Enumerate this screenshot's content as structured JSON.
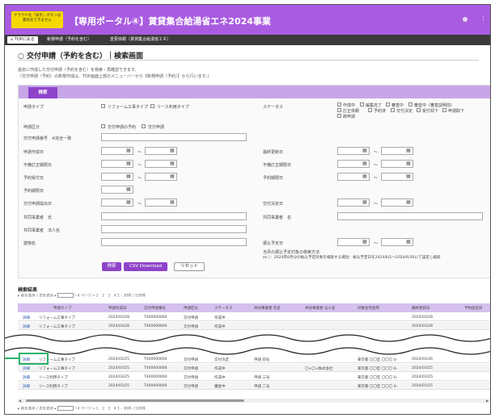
{
  "header": {
    "badge_line1": "クラウド化「表示」ボタンは",
    "badge_line2": "無効化できません",
    "title": "【専用ポータル④】賃貸集合給湯省エネ2024事業",
    "more_icon": "⋮"
  },
  "nav": {
    "home": "TOPに戻る",
    "items": [
      "新規申請（予約を含む）",
      "変更依頼（賃貸集合給湯省エネ）"
    ]
  },
  "page": {
    "title": "○ 交付申請（予約を含む）｜検索画面",
    "desc1": "過去に作成した交付申請（予約を含む）を検索・再確認できます。",
    "desc2": "（交付申請（予約）の新規作成は、TOP画面上部のメニューバーから【新規申請（予約）】から行います。）"
  },
  "search": {
    "tab_label": "検索",
    "labels": {
      "apply_type": "申請タイプ",
      "status": "ステータス",
      "apply_category": "申請区分",
      "apply_number": "交付申請番号",
      "apply_number_note": "※完全一致",
      "created_date": "申請作成日",
      "last_updated": "最終更新日",
      "defect_date": "不備訂正期限日",
      "defect_fix_date": "不備訂正期限日",
      "booking_date": "予約受付日",
      "booking_deadline": "予約期限日",
      "booking_limit": "予約期限日",
      "submit_date": "交付申請提出日",
      "decision_date": "交付決定日",
      "joint_name": "共同事業者　氏",
      "joint_name_first": "共同事業者　名",
      "joint_corp": "共同事業者　法人名",
      "building": "建物名",
      "transfer_date": "振込予定日"
    },
    "type_options": [
      "リフォーム工事タイプ",
      "リース利用タイプ"
    ],
    "category_options": [
      "交付申請の予約",
      "交付申請"
    ],
    "status_options": [
      "作成中",
      "編集完了",
      "審査中",
      "審査中（審査説明前）",
      "訂正依頼",
      "予約済",
      "交付決定",
      "受付却下",
      "申請取下",
      "辞申請"
    ],
    "tilde": "～",
    "calendar_icon": "▦",
    "transfer_note1": "当月の振込予定対象の検索方法",
    "transfer_note2": "ex.）：2024年6月分の振込予定対象を検索する場合：振込予定日を2024/6/1～2024/6/30にて設定し検索",
    "btn_search": "検索",
    "btn_csv": "CSV Download",
    "btn_reset": "リセット"
  },
  "results": {
    "title": "検索結果",
    "pager_text_before": "▸ 前を表示 / 次を表示 ▸",
    "pager_total": "/ 4 ページ",
    "pager_pages": "1　2　3　4",
    "pager_count": "1 - 30件 / 109件",
    "columns": [
      "申請タイプ",
      "申請作成日",
      "交付申請番号",
      "申請区分",
      "ステータス",
      "共同事業者 氏名",
      "共同事業者 法人名",
      "対象住宅住所",
      "最終更新日",
      "予約提出日"
    ],
    "rows_top": [
      {
        "action": "詳細",
        "type": "リフォーム工事タイプ",
        "created": "2024/03/28",
        "number": "T400000000",
        "category": "交付申請",
        "status": "作成中",
        "name": "",
        "corp": "",
        "address": "",
        "updated": "2024/03/28"
      },
      {
        "action": "詳細",
        "type": "リフォーム工事タイプ",
        "created": "2024/03/28",
        "number": "T400000000",
        "category": "交付申請",
        "status": "作成中",
        "name": "",
        "corp": "",
        "address": "",
        "updated": "2024/03/28"
      }
    ],
    "rows_bottom": [
      {
        "action": "詳細",
        "type": "リフォーム工事タイプ",
        "created": "2024/03/25",
        "number": "T400000000",
        "category": "交付申請",
        "status": "交付決定",
        "name": "申請 四号",
        "corp": "",
        "address": "東京都 〇〇区 〇〇〇 0-",
        "updated": "2024/03/26"
      },
      {
        "action": "詳細",
        "type": "リフォーム工事タイプ",
        "created": "2024/03/25",
        "number": "T400000000",
        "category": "交付申請",
        "status": "作成中",
        "name": "",
        "corp": "〇×〇×株式会社",
        "address": "東京都 〇〇区 〇〇〇 0-",
        "updated": "2024/03/25"
      },
      {
        "action": "詳細",
        "type": "リース利用タイプ",
        "created": "2024/03/25",
        "number": "T400000000",
        "category": "交付申請",
        "status": "作成中",
        "name": "申請 三号",
        "corp": "",
        "address": "東京都 〇〇区 〇〇〇 0-",
        "updated": "2024/03/25"
      },
      {
        "action": "詳細",
        "type": "リース利用タイプ",
        "created": "2024/03/25",
        "number": "T400000000",
        "category": "交付申請",
        "status": "審査中",
        "name": "申請 二号",
        "corp": "",
        "address": "東京都 〇〇区 〇〇〇 0-",
        "updated": "2024/03/25"
      }
    ]
  },
  "colors": {
    "header": "#a95ce0",
    "accent": "#8e43c9",
    "highlight": "#2bb36b"
  }
}
